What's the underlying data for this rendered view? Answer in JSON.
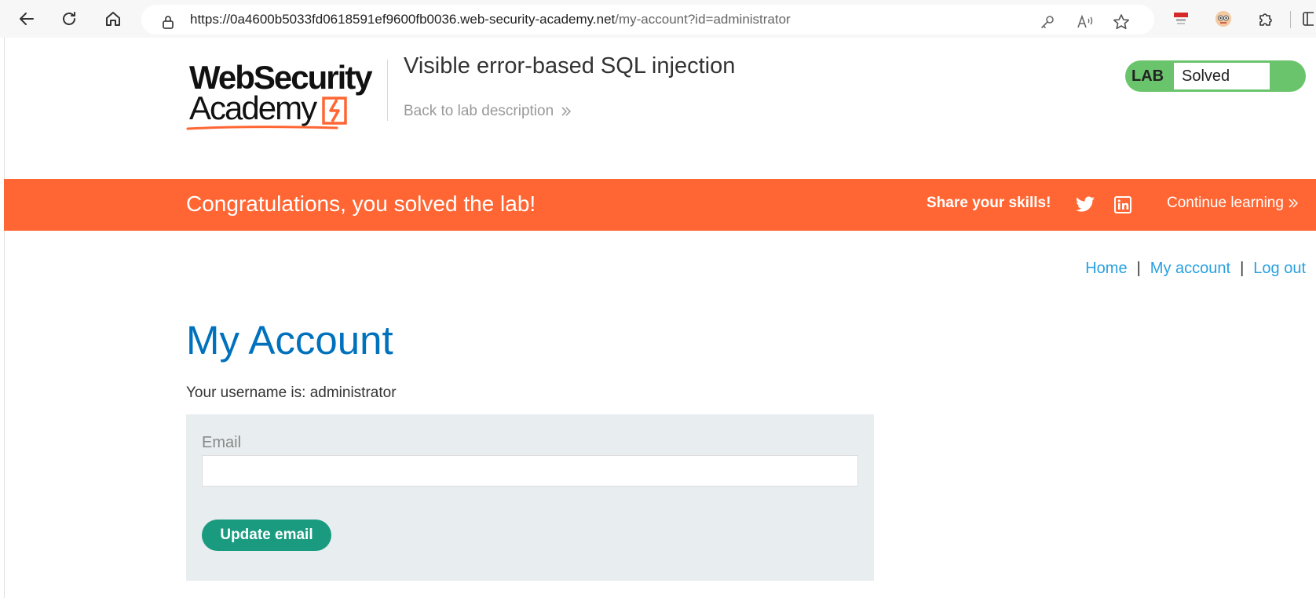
{
  "browser": {
    "url_host": "https://0a4600b5033fd0618591ef9600fb0036.web-security-academy.net",
    "url_path": "/my-account?id=administrator",
    "icons": [
      "back-arrow-icon",
      "refresh-icon",
      "home-icon",
      "lock-icon",
      "key-icon",
      "read-aloud-icon",
      "favorite-star-icon",
      "extension-flag-icon",
      "profile-avatar-icon",
      "extensions-puzzle-icon",
      "sidebar-icon"
    ]
  },
  "header": {
    "logo_line1": "WebSecurity",
    "logo_line2": "Academy",
    "lab_title": "Visible error-based SQL injection",
    "back_link": "Back to lab description",
    "lab_label": "LAB",
    "lab_status": "Solved"
  },
  "banner": {
    "message": "Congratulations, you solved the lab!",
    "share": "Share your skills!",
    "continue": "Continue learning"
  },
  "nav": {
    "home": "Home",
    "separator": "|",
    "my_account": "My account",
    "log_out": "Log out"
  },
  "account": {
    "title": "My Account",
    "username_text": "Your username is: administrator",
    "email_label": "Email",
    "email_value": "",
    "update_button": "Update email"
  },
  "colors": {
    "accent_orange": "#ff6633",
    "lab_green": "#6ac46c",
    "title_blue": "#0071bc",
    "link_blue": "#29a0e0",
    "button_teal": "#1a9b80"
  }
}
